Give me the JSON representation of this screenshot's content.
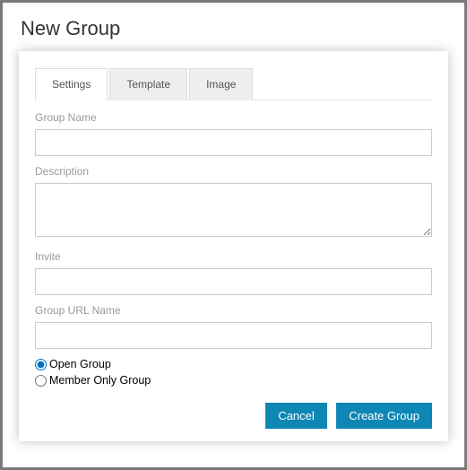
{
  "title": "New Group",
  "tabs": [
    {
      "label": "Settings",
      "active": true
    },
    {
      "label": "Template",
      "active": false
    },
    {
      "label": "Image",
      "active": false
    }
  ],
  "fields": {
    "groupName": {
      "label": "Group Name",
      "value": ""
    },
    "description": {
      "label": "Description",
      "value": ""
    },
    "invite": {
      "label": "Invite",
      "value": ""
    },
    "groupUrlName": {
      "label": "Group URL Name",
      "value": ""
    }
  },
  "groupType": {
    "open": {
      "label": "Open Group",
      "checked": true
    },
    "member": {
      "label": "Member Only Group",
      "checked": false
    }
  },
  "buttons": {
    "cancel": "Cancel",
    "create": "Create Group"
  }
}
